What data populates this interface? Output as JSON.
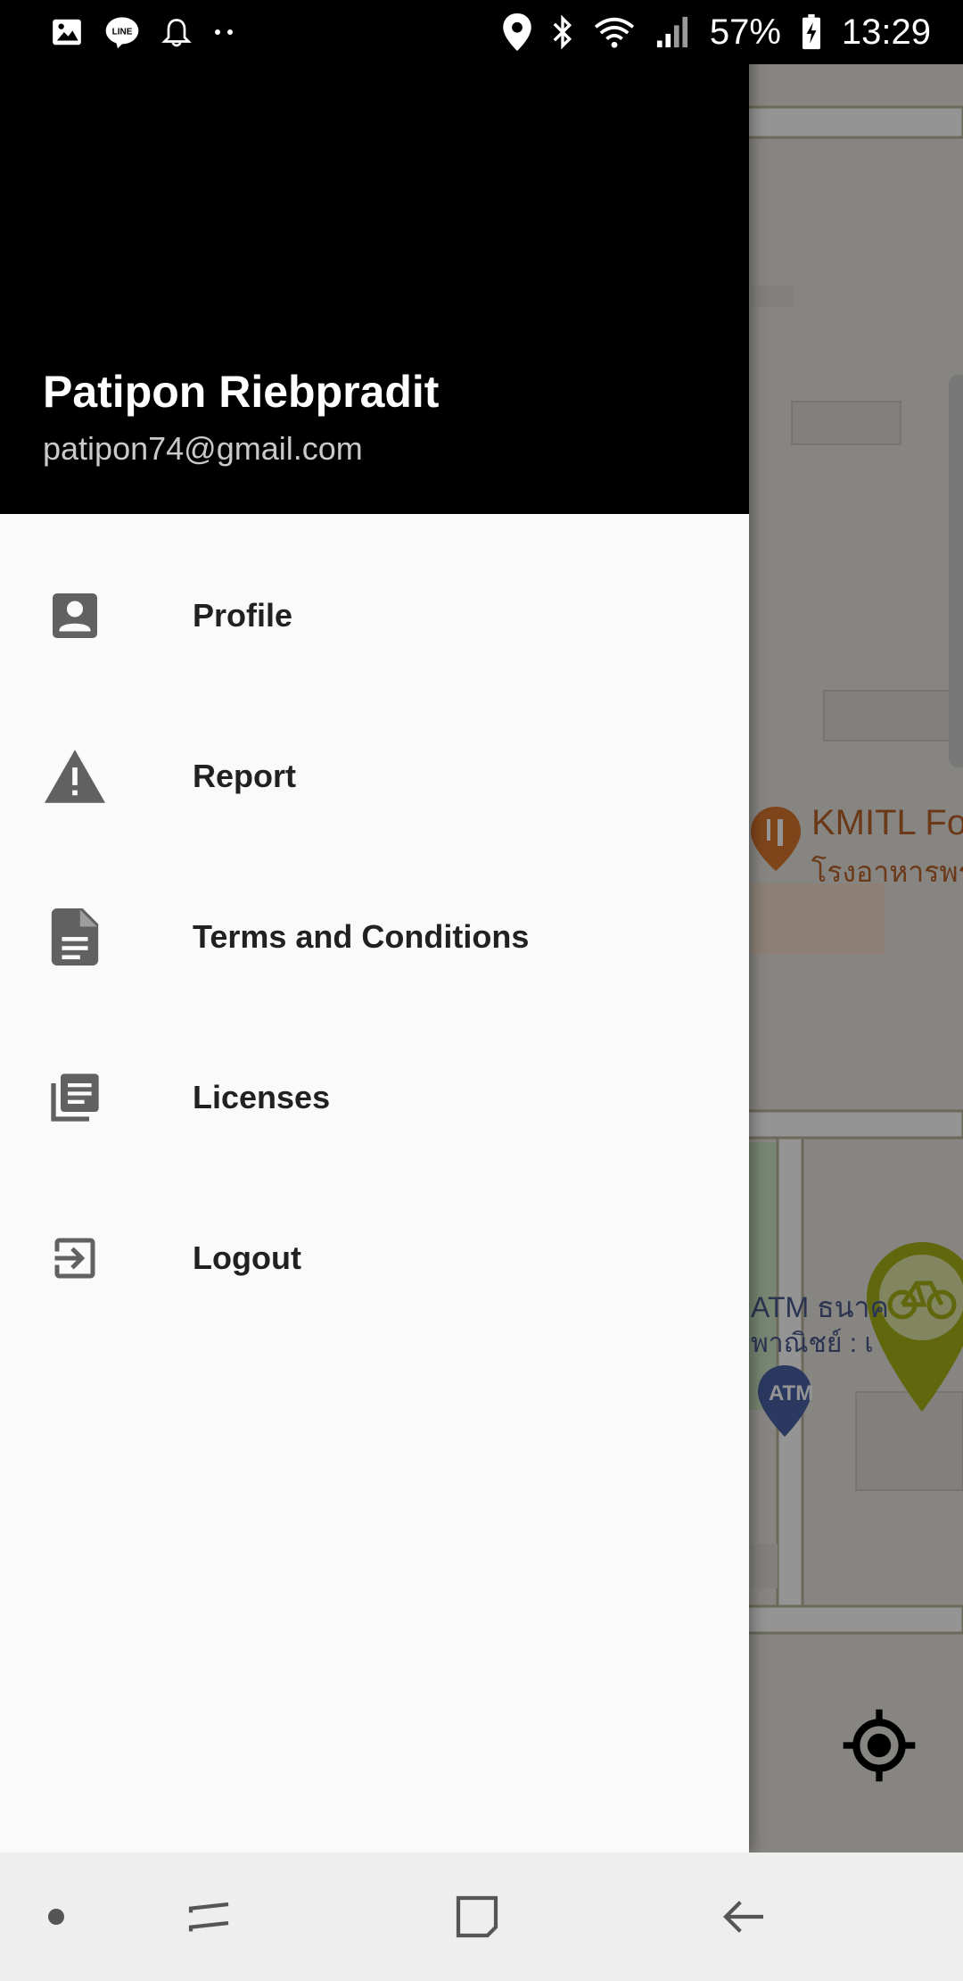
{
  "status_bar": {
    "battery": "57%",
    "time": "13:29"
  },
  "drawer": {
    "user": {
      "name": "Patipon Riebpradit",
      "email": "patipon74@gmail.com"
    },
    "menu": [
      {
        "label": "Profile",
        "icon": "account-box-icon"
      },
      {
        "label": "Report",
        "icon": "warning-icon"
      },
      {
        "label": "Terms and Conditions",
        "icon": "document-icon"
      },
      {
        "label": "Licenses",
        "icon": "library-books-icon"
      },
      {
        "label": "Logout",
        "icon": "exit-to-app-icon"
      }
    ]
  },
  "map": {
    "food_poi_title": "KMITL Fo",
    "food_poi_sub": "โรงอาหารพร",
    "atm_poi_title": "ATM ธนาค",
    "atm_poi_sub": "พาณิชย์ : เ",
    "atm_pin_label": "ATM"
  },
  "navbar": {
    "buttons": [
      "dot",
      "recents",
      "home",
      "back"
    ]
  },
  "colors": {
    "drawer_header_bg": "#000000",
    "drawer_bg": "#fafafa",
    "menu_icon": "#616161",
    "bike_pin": "#a6b217",
    "food_pin": "#d9782f",
    "atm_pin": "#4a62a8"
  }
}
